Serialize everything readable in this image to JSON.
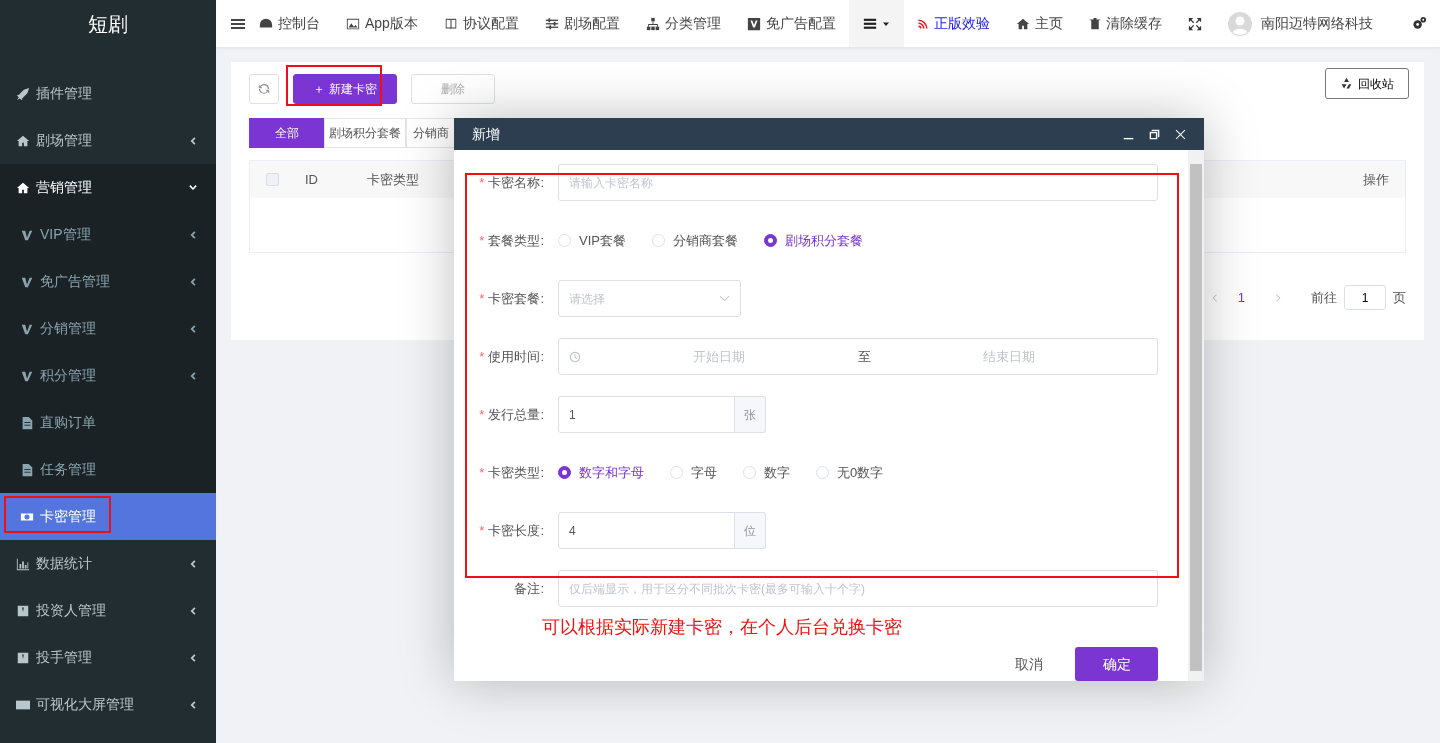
{
  "app": {
    "title": "短剧"
  },
  "sidebar": {
    "items": [
      {
        "label": "插件管理",
        "kind": "link",
        "selected": false
      },
      {
        "label": "剧场管理",
        "kind": "group",
        "expanded": false,
        "selected": false
      },
      {
        "label": "营销管理",
        "kind": "group",
        "expanded": true,
        "selected": false,
        "children": [
          {
            "label": "VIP管理",
            "kind": "group",
            "expanded": false,
            "selected": false
          },
          {
            "label": "免广告管理",
            "kind": "group",
            "expanded": false,
            "selected": false
          },
          {
            "label": "分销管理",
            "kind": "group",
            "expanded": false,
            "selected": false
          },
          {
            "label": "积分管理",
            "kind": "group",
            "expanded": false,
            "selected": false
          },
          {
            "label": "直购订单",
            "kind": "link",
            "selected": false
          },
          {
            "label": "任务管理",
            "kind": "link",
            "selected": false
          },
          {
            "label": "卡密管理",
            "kind": "link",
            "selected": true
          }
        ]
      },
      {
        "label": "数据统计",
        "kind": "group",
        "expanded": false,
        "selected": false
      },
      {
        "label": "投资人管理",
        "kind": "group",
        "expanded": false,
        "selected": false
      },
      {
        "label": "投手管理",
        "kind": "group",
        "expanded": false,
        "selected": false
      },
      {
        "label": "可视化大屏管理",
        "kind": "group",
        "expanded": false,
        "selected": false
      }
    ]
  },
  "topbar": {
    "items": [
      {
        "label": "控制台",
        "kind": "plain"
      },
      {
        "label": "App版本",
        "kind": "plain"
      },
      {
        "label": "协议配置",
        "kind": "plain"
      },
      {
        "label": "剧场配置",
        "kind": "plain"
      },
      {
        "label": "分类管理",
        "kind": "plain"
      },
      {
        "label": "免广告配置",
        "kind": "plain"
      },
      {
        "kind": "dropdown"
      },
      {
        "label": "正版效验",
        "kind": "highlight"
      },
      {
        "label": "主页",
        "kind": "plain"
      },
      {
        "label": "清除缓存",
        "kind": "plain"
      },
      {
        "kind": "fullscreen"
      },
      {
        "label": "南阳迈特网络科技",
        "kind": "user"
      },
      {
        "kind": "settings"
      }
    ]
  },
  "toolbar": {
    "buttons": [
      {
        "kind": "refresh"
      },
      {
        "label": "＋ 新建卡密",
        "kind": "primary",
        "disabled": false
      },
      {
        "label": "删除",
        "kind": "default",
        "disabled": true
      }
    ],
    "recycle": {
      "label": "回收站"
    }
  },
  "tabs": [
    {
      "label": "全部",
      "selected": true
    },
    {
      "label": "剧场积分套餐",
      "selected": false
    },
    {
      "label": "分销商",
      "selected": false
    }
  ],
  "table": {
    "select_all_checked": false,
    "columns": [
      "ID",
      "卡密类型",
      "操作"
    ]
  },
  "pagination": {
    "current": "1",
    "goto_label": "前往",
    "goto_value": "1",
    "page_label": "页"
  },
  "modal": {
    "title": "新增",
    "required_mark": "*",
    "fields": [
      {
        "label": "卡密名称:",
        "required": true,
        "kind": "text",
        "placeholder": "请输入卡密名称"
      },
      {
        "label": "套餐类型:",
        "required": true,
        "kind": "radio",
        "options": [
          {
            "label": "VIP套餐",
            "selected": false
          },
          {
            "label": "分销商套餐",
            "selected": false
          },
          {
            "label": "剧场积分套餐",
            "selected": true
          }
        ]
      },
      {
        "label": "卡密套餐:",
        "required": true,
        "kind": "select",
        "placeholder": "请选择"
      },
      {
        "label": "使用时间:",
        "required": true,
        "kind": "daterange",
        "start_placeholder": "开始日期",
        "separator": "至",
        "end_placeholder": "结束日期"
      },
      {
        "label": "发行总量:",
        "required": true,
        "kind": "addon",
        "value": "1",
        "addon": "张"
      },
      {
        "label": "卡密类型:",
        "required": true,
        "kind": "radio",
        "options": [
          {
            "label": "数字和字母",
            "selected": true
          },
          {
            "label": "字母",
            "selected": false
          },
          {
            "label": "数字",
            "selected": false
          },
          {
            "label": "无0数字",
            "selected": false
          }
        ]
      },
      {
        "label": "卡密长度:",
        "required": true,
        "kind": "addon",
        "value": "4",
        "addon": "位"
      },
      {
        "label": "备注:",
        "required": false,
        "kind": "text",
        "placeholder": "仅后端显示，用于区分不同批次卡密(最多可输入十个字)"
      }
    ],
    "buttons": [
      {
        "label": "取消",
        "kind": "cancel"
      },
      {
        "label": "确定",
        "kind": "confirm"
      }
    ]
  },
  "annotation": {
    "text": "可以根据实际新建卡密，在个人后台兑换卡密"
  }
}
